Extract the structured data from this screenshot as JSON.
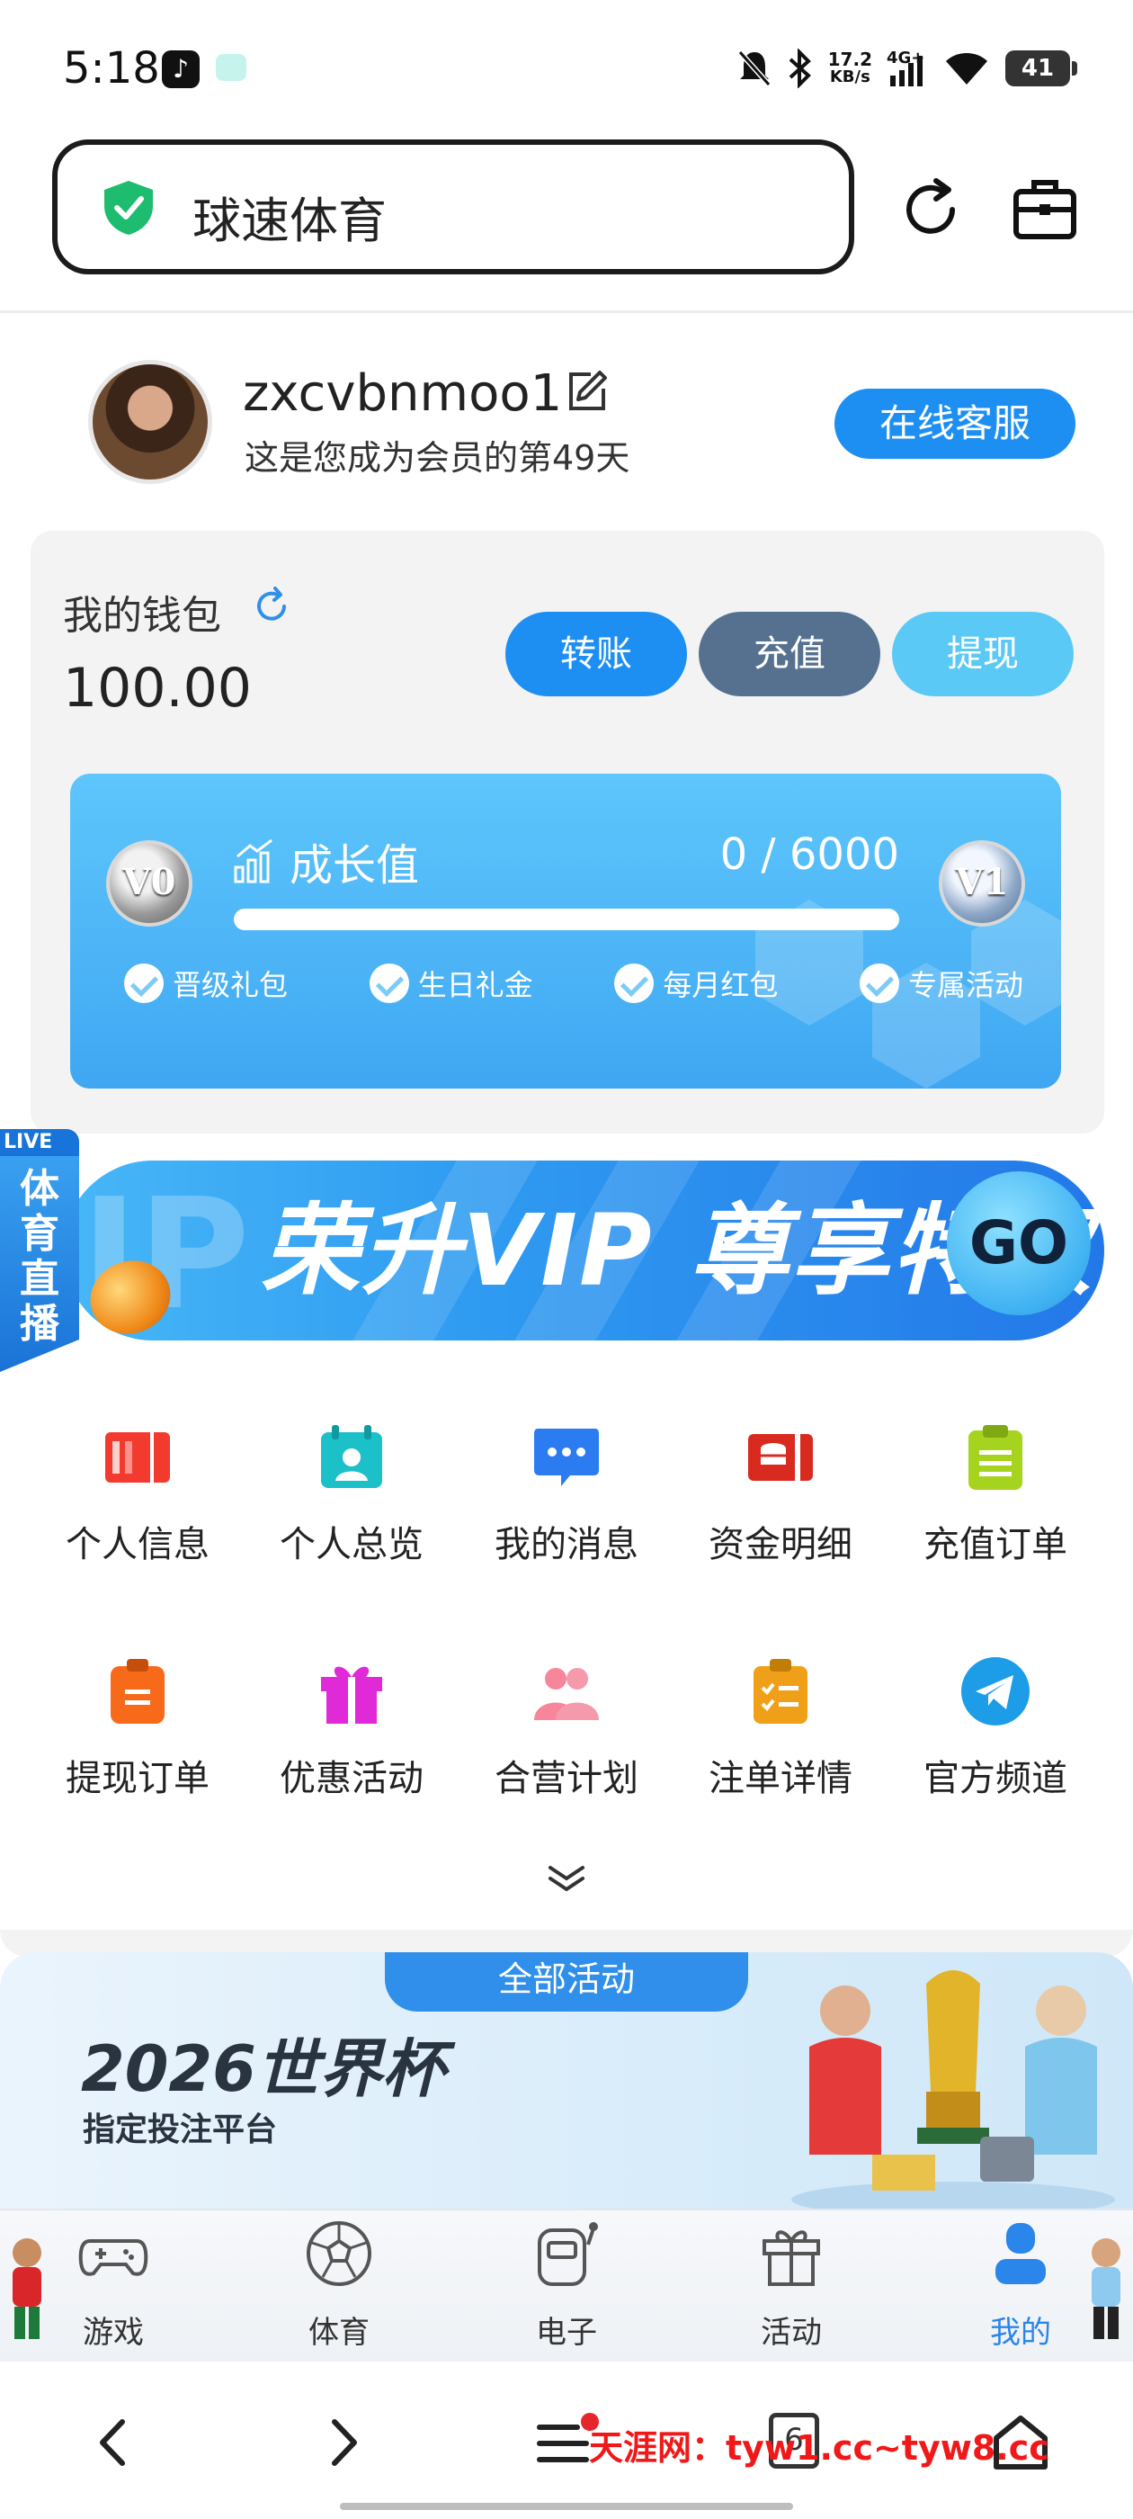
{
  "status_bar": {
    "time": "5:18",
    "network_speed": "17.2",
    "network_unit": "KB/s",
    "network_type": "4G+",
    "battery": "41"
  },
  "browser": {
    "site_title": "球速体育"
  },
  "profile": {
    "username": "zxcvbnmoo1",
    "member_days_text": "这是您成为会员的第49天",
    "service_button": "在线客服"
  },
  "wallet": {
    "title": "我的钱包",
    "balance": "100.00",
    "transfer_label": "转账",
    "deposit_label": "充值",
    "withdraw_label": "提现"
  },
  "growth": {
    "label": "成长值",
    "value_text": "0 / 6000",
    "progress_fraction": 0,
    "current_level": "V0",
    "next_level": "V1",
    "perks": [
      "晋级礼包",
      "生日礼金",
      "每月红包",
      "专属活动"
    ]
  },
  "live_tab": {
    "badge": "LIVE",
    "text": "体育直播"
  },
  "vip_banner": {
    "text": "荣升VIP 尊享特权",
    "go_label": "GO"
  },
  "menu_grid": [
    {
      "label": "个人信息",
      "icon": "id-card-icon",
      "color": "#f23b2e"
    },
    {
      "label": "个人总览",
      "icon": "profile-overview-icon",
      "color": "#1cc0c8"
    },
    {
      "label": "我的消息",
      "icon": "message-icon",
      "color": "#2b7cf0"
    },
    {
      "label": "资金明细",
      "icon": "funds-icon",
      "color": "#d92a20"
    },
    {
      "label": "充值订单",
      "icon": "clipboard-icon",
      "color": "#a6d41e"
    },
    {
      "label": "提现订单",
      "icon": "withdraw-order-icon",
      "color": "#f76a1a"
    },
    {
      "label": "优惠活动",
      "icon": "gift-icon",
      "color": "#e02ad8"
    },
    {
      "label": "合营计划",
      "icon": "partners-icon",
      "color": "#f7869a"
    },
    {
      "label": "注单详情",
      "icon": "bet-details-icon",
      "color": "#f0a018"
    },
    {
      "label": "官方频道",
      "icon": "telegram-icon",
      "color": "#1d9de8"
    }
  ],
  "events": {
    "tab_label": "全部活动",
    "title": "2026世界杯",
    "subtitle": "指定投注平台"
  },
  "bottom_nav": [
    {
      "label": "游戏",
      "icon": "gamepad-icon",
      "active": false
    },
    {
      "label": "体育",
      "icon": "soccer-ball-icon",
      "active": false
    },
    {
      "label": "电子",
      "icon": "slot-machine-icon",
      "active": false
    },
    {
      "label": "活动",
      "icon": "gift-box-icon",
      "active": false
    },
    {
      "label": "我的",
      "icon": "user-icon",
      "active": true
    }
  ],
  "system_nav": {
    "tab_count": "6",
    "watermark": "天涯网：tyw1.cc~tyw8.cc"
  },
  "colors": {
    "primary": "#1d8ff2",
    "deposit": "#56708f",
    "withdraw": "#5bc9f5",
    "active_nav": "#2a86ea",
    "watermark": "#f01818"
  }
}
